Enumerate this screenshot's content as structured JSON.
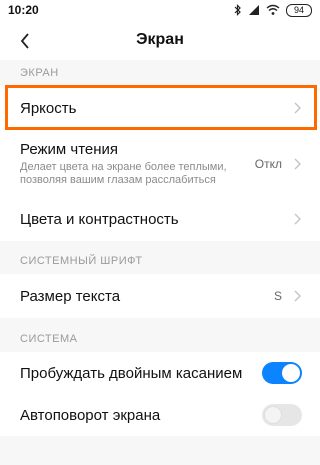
{
  "status_bar": {
    "time": "10:20",
    "battery": "94",
    "icons": [
      "bluetooth-icon",
      "signal-icon",
      "wifi-icon",
      "battery-icon"
    ]
  },
  "header": {
    "title": "Экран",
    "back_icon": "back-arrow-icon"
  },
  "sections": {
    "screen": {
      "label": "ЭКРАН",
      "brightness": {
        "title": "Яркость"
      },
      "reading_mode": {
        "title": "Режим чтения",
        "subtitle_line1": "Делает цвета на экране более теплыми,",
        "subtitle_line2": "позволяя вашим глазам расслабиться",
        "value": "Откл"
      },
      "colors": {
        "title": "Цвета и контрастность"
      }
    },
    "font": {
      "label": "СИСТЕМНЫЙ ШРИФТ",
      "text_size": {
        "title": "Размер текста",
        "value": "S"
      }
    },
    "system": {
      "label": "СИСТЕМА",
      "double_tap": {
        "title": "Пробуждать двойным касанием",
        "enabled": true
      },
      "auto_rotate": {
        "title": "Автоповорот экрана",
        "enabled": false
      }
    }
  },
  "colors": {
    "accent": "#0d84ff",
    "highlight": "#ff6a00",
    "section_bg": "#f7f7f7"
  }
}
